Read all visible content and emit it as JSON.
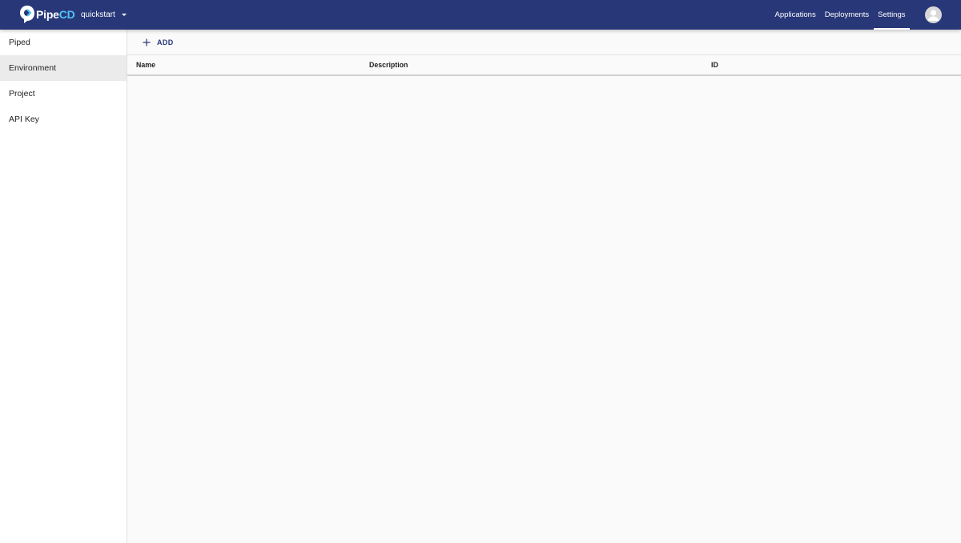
{
  "header": {
    "logo_text_main": "Pipe",
    "logo_text_accent": "CD",
    "project": "quickstart",
    "nav": [
      "Applications",
      "Deployments",
      "Settings"
    ],
    "active_nav": "Settings"
  },
  "sidebar": {
    "items": [
      {
        "label": "Piped"
      },
      {
        "label": "Environment"
      },
      {
        "label": "Project"
      },
      {
        "label": "API Key"
      }
    ],
    "selected": "Environment"
  },
  "main": {
    "add_label": "ADD",
    "columns": [
      "Name",
      "Description",
      "ID"
    ]
  },
  "colors": {
    "appbar": "#283778",
    "accent": "#4fc3f7"
  }
}
